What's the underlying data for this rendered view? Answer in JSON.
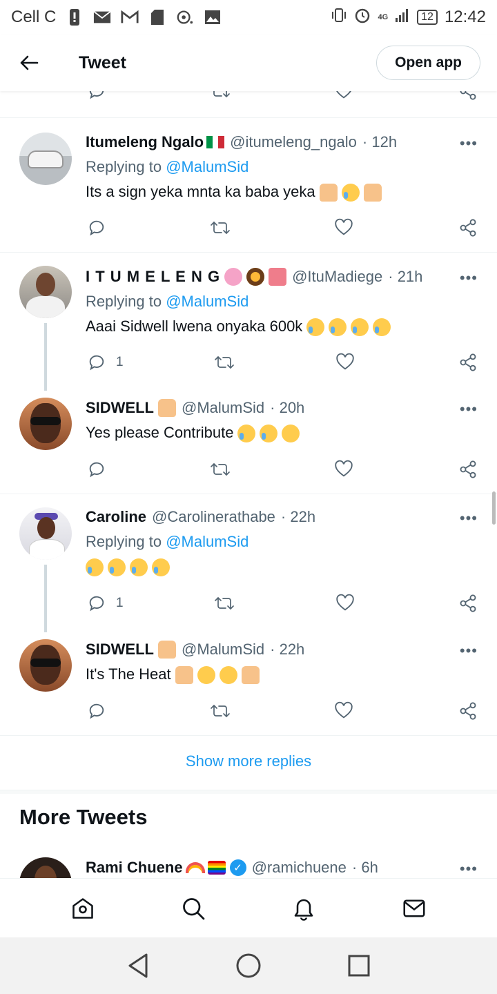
{
  "status_bar": {
    "carrier": "Cell C",
    "network": "4G",
    "battery": "12",
    "time": "12:42"
  },
  "header": {
    "title": "Tweet",
    "open_app": "Open app"
  },
  "tweets": [
    {
      "name": "Itumeleng Ngalo",
      "handle": "@itumeleng_ngalo",
      "time": "· 12h",
      "replying_label": "Replying to",
      "replying_to": "@MalumSid",
      "text": "Its a sign yeka mnta ka baba yeka",
      "reply_count": ""
    },
    {
      "name": "I T U M E L E N G",
      "handle": "@ItuMadiege",
      "time": "· 21h",
      "replying_label": "Replying to",
      "replying_to": "@MalumSid",
      "text": "Aaai Sidwell lwena onyaka 600k",
      "reply_count": "1"
    },
    {
      "name": "SIDWELL",
      "handle": "@MalumSid",
      "time": "· 20h",
      "text": "Yes please Contribute",
      "reply_count": ""
    },
    {
      "name": "Caroline",
      "handle": "@Carolinerathabe",
      "time": "· 22h",
      "replying_label": "Replying to",
      "replying_to": "@MalumSid",
      "text": "",
      "reply_count": "1"
    },
    {
      "name": "SIDWELL",
      "handle": "@MalumSid",
      "time": "· 22h",
      "text": "It's The Heat",
      "reply_count": ""
    }
  ],
  "show_more": "Show more replies",
  "more_tweets": {
    "title": "More Tweets",
    "first": {
      "name": "Rami Chuene",
      "handle": "@ramichuene",
      "time": "· 6h"
    }
  },
  "more_glyph": "•••",
  "colors": {
    "link": "#1d9bf0",
    "muted": "#536471",
    "text": "#0f1419"
  }
}
